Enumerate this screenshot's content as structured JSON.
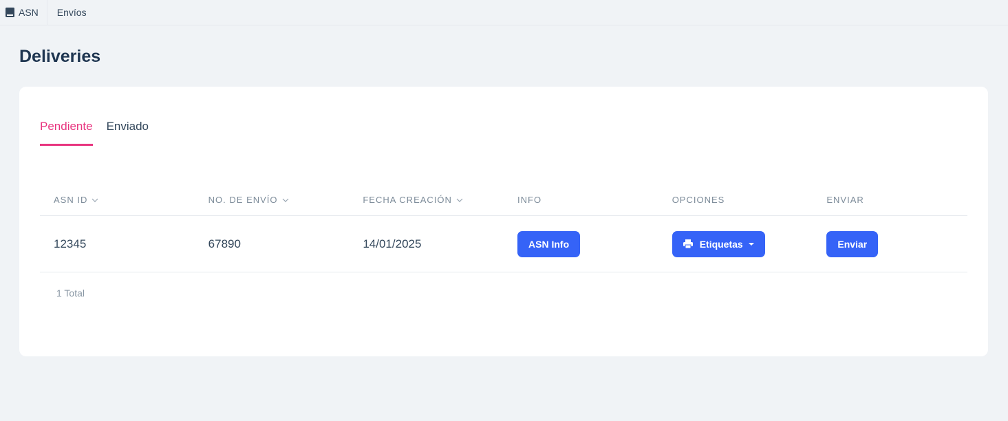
{
  "breadcrumb": {
    "app": "ASN",
    "section": "Envíos"
  },
  "page_title": "Deliveries",
  "tabs": [
    {
      "label": "Pendiente",
      "active": true
    },
    {
      "label": "Enviado",
      "active": false
    }
  ],
  "table": {
    "headers": [
      "ASN ID",
      "NO. DE ENVÍO",
      "FECHA CREACIÓN",
      "INFO",
      "OPCIONES",
      "ENVIAR"
    ],
    "rows": [
      {
        "asn_id": "12345",
        "no_envio": "67890",
        "fecha": "14/01/2025",
        "info_btn": "ASN Info",
        "opciones_btn": "Etiquetas",
        "enviar_btn": "Enviar"
      }
    ]
  },
  "total_text": "1 Total",
  "colors": {
    "accent": "#e8357f",
    "primary_button": "#3563f7",
    "background": "#f0f3f6"
  },
  "icons": {
    "breadcrumb": "book-icon",
    "print": "printer-icon",
    "sort": "chevron-down-icon"
  }
}
